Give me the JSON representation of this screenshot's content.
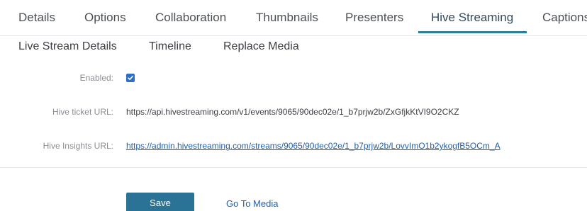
{
  "tabs": {
    "items": [
      {
        "label": "Details"
      },
      {
        "label": "Options"
      },
      {
        "label": "Collaboration"
      },
      {
        "label": "Thumbnails"
      },
      {
        "label": "Presenters"
      },
      {
        "label": "Hive Streaming",
        "active": true
      },
      {
        "label": "Captions"
      }
    ]
  },
  "subtabs": {
    "items": [
      {
        "label": "Live Stream Details"
      },
      {
        "label": "Timeline"
      },
      {
        "label": "Replace Media"
      }
    ]
  },
  "form": {
    "enabled": {
      "label": "Enabled:",
      "checked": true
    },
    "ticket_url": {
      "label": "Hive ticket URL:",
      "value": "https://api.hivestreaming.com/v1/events/9065/90dec02e/1_b7prjw2b/ZxGfjkKtVI9O2CKZ"
    },
    "insights_url": {
      "label": "Hive Insights URL:",
      "value": "https://admin.hivestreaming.com/streams/9065/90dec02e/1_b7prjw2b/LovvImO1b2ykogfB5OCm_A"
    }
  },
  "actions": {
    "save_label": "Save",
    "goto_media_label": "Go To Media"
  },
  "colors": {
    "accent": "#2a7396",
    "tab_underline": "#2e7d9c",
    "link": "#1f5fa8",
    "checkbox": "#2e6fc4"
  }
}
